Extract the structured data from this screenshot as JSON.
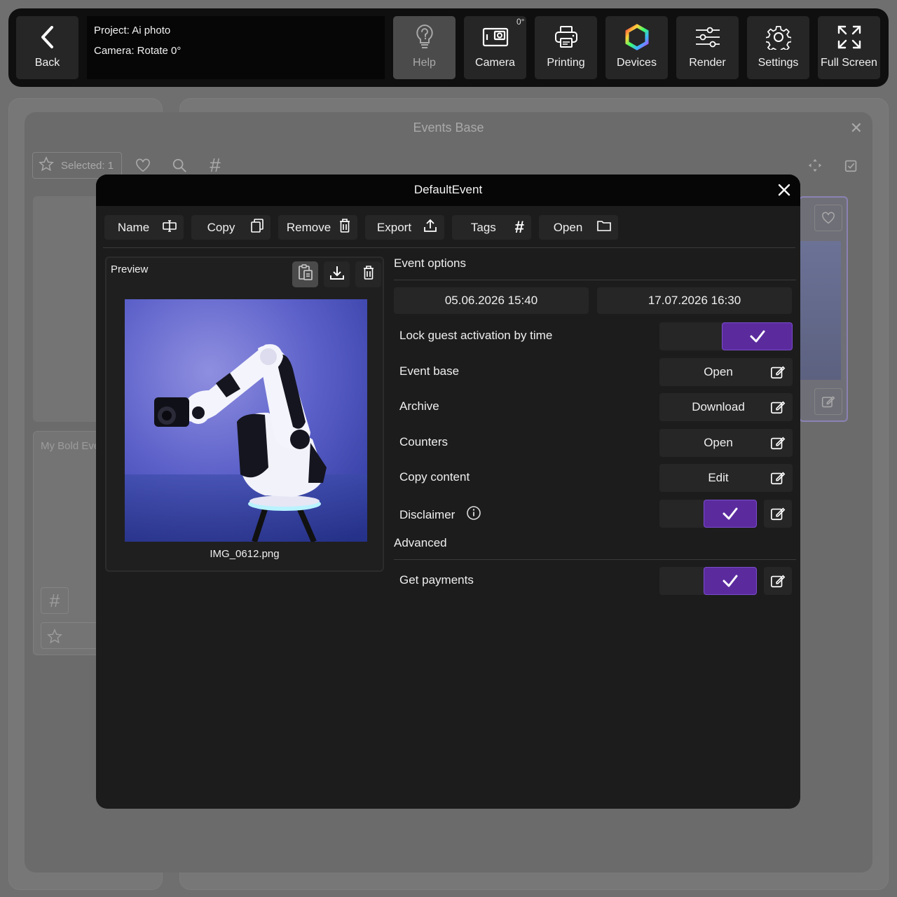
{
  "toolbar": {
    "back_label": "Back",
    "project_line": "Project: Ai photo",
    "camera_line": "Camera: Rotate 0°",
    "help_label": "Help",
    "camera_label": "Camera",
    "camera_rotation": "0°",
    "printing_label": "Printing",
    "devices_label": "Devices",
    "render_label": "Render",
    "settings_label": "Settings",
    "fullscreen_label": "Full Screen"
  },
  "events_base": {
    "title": "Events Base",
    "selected_label": "Selected: 1",
    "card_title": "My Bold Eve"
  },
  "modal": {
    "title": "DefaultEvent",
    "actions": {
      "name": "Name",
      "copy": "Copy",
      "remove": "Remove",
      "export": "Export",
      "tags": "Tags",
      "open": "Open"
    },
    "preview": {
      "title": "Preview",
      "filename": "IMG_0612.png"
    },
    "event_options": {
      "heading": "Event options",
      "start_date": "05.06.2026 15:40",
      "end_date": "17.07.2026 16:30",
      "lock_label": "Lock guest activation by time",
      "lock_enabled": true,
      "event_base_label": "Event base",
      "event_base_button": "Open",
      "archive_label": "Archive",
      "archive_button": "Download",
      "counters_label": "Counters",
      "counters_button": "Open",
      "copy_content_label": "Copy content",
      "copy_content_button": "Edit",
      "disclaimer_label": "Disclaimer",
      "disclaimer_enabled": true
    },
    "advanced": {
      "heading": "Advanced",
      "payments_label": "Get payments",
      "payments_enabled": true
    }
  },
  "colors": {
    "accent_purple": "#5b2b9e",
    "modal_bg": "#1c1c1c",
    "toolbar_bg": "#0f0f0f"
  }
}
